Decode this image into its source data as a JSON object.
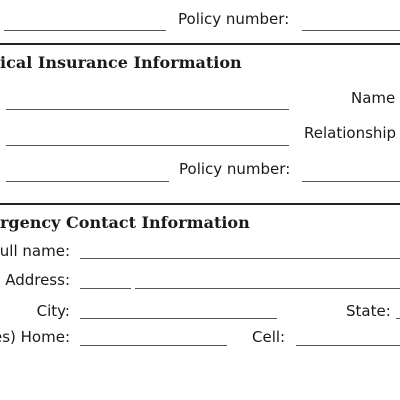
{
  "section_top": {
    "policy_number_label": "Policy number:"
  },
  "medical_insurance": {
    "heading": "ical Insurance Information",
    "name_label": "Name",
    "relationship_label": "Relationship",
    "policy_number_label": "Policy number:"
  },
  "emergency_contact": {
    "heading": "rgency Contact Information",
    "full_name_label": "ull name:",
    "address_label": "Address:",
    "city_label": "City:",
    "state_label": "State:",
    "phones_home_label": "es) Home:",
    "cell_label": "Cell:"
  }
}
